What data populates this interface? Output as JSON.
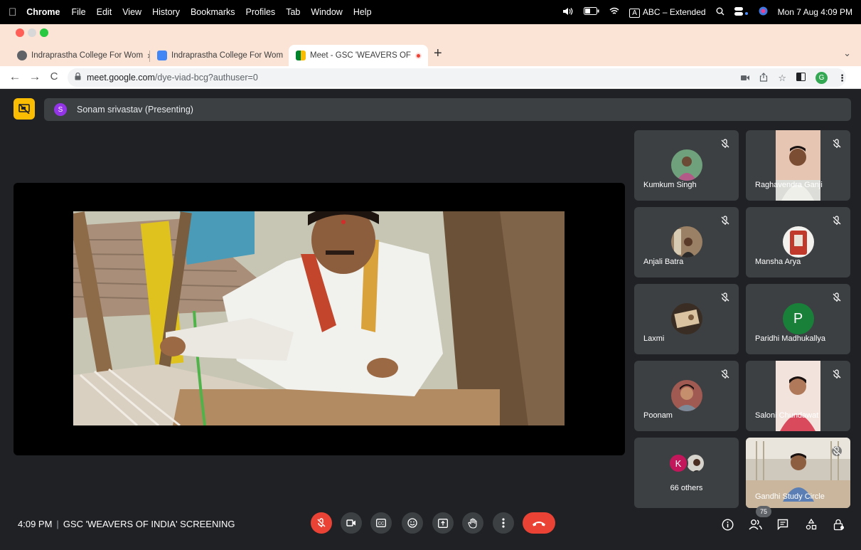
{
  "menubar": {
    "app_name": "Chrome",
    "menus": [
      "File",
      "Edit",
      "View",
      "History",
      "Bookmarks",
      "Profiles",
      "Tab",
      "Window",
      "Help"
    ],
    "input_badge": "A",
    "input_source": "ABC – Extended",
    "datetime": "Mon 7 Aug  4:09 PM"
  },
  "tabs": [
    {
      "title": "Indraprastha College For Wom",
      "favicon_color": "#5f6368",
      "close": "×"
    },
    {
      "title": "Indraprastha College For Wom",
      "favicon_color": "#4285f4",
      "close": "×"
    },
    {
      "title": "Meet - GSC 'WEAVERS OF",
      "favicon_color": "#00832d",
      "close": "×"
    }
  ],
  "new_tab_label": "+",
  "tab_menu_label": "⌄",
  "address_bar": {
    "url_host": "meet.google.com",
    "url_path": "/dye-viad-bcg?authuser=0",
    "profile_letter": "G"
  },
  "presenter": {
    "initial": "S",
    "label": "Sonam srivastav (Presenting)"
  },
  "participants": [
    {
      "name": "Kumkum Singh",
      "type": "photo",
      "bg": "#5e8f6a"
    },
    {
      "name": "Raghavendra Ganji",
      "type": "camera",
      "bg": "#d8b9a8"
    },
    {
      "name": "Anjali Batra",
      "type": "photo",
      "bg": "#8a6f5a"
    },
    {
      "name": "Mansha Arya",
      "type": "photo",
      "bg": "#c0392b"
    },
    {
      "name": "Laxmi",
      "type": "photo",
      "bg": "#7d6a55"
    },
    {
      "name": "Paridhi Madhukallya",
      "type": "letter",
      "letter": "P",
      "bg": "#188038"
    },
    {
      "name": "Poonam",
      "type": "photo",
      "bg": "#a0574e"
    },
    {
      "name": "Saloni Chundawat",
      "type": "camera",
      "bg": "#e9d3cb"
    },
    {
      "name": "66 others",
      "type": "others",
      "letter": "K",
      "bg": "#c2185b"
    },
    {
      "name": "Gandhi Study Circle",
      "type": "camera-wide",
      "bg": "#c9c3b8"
    }
  ],
  "bottom_bar": {
    "time": "4:09 PM",
    "meeting_title": "GSC 'WEAVERS OF INDIA' SCREENING",
    "people_count": "75"
  },
  "colors": {
    "meet_bg": "#202124",
    "tile_bg": "#3c4043",
    "hangup_red": "#ea4335",
    "present_yellow": "#fbbc04",
    "window_chrome": "#fbe4d6"
  }
}
